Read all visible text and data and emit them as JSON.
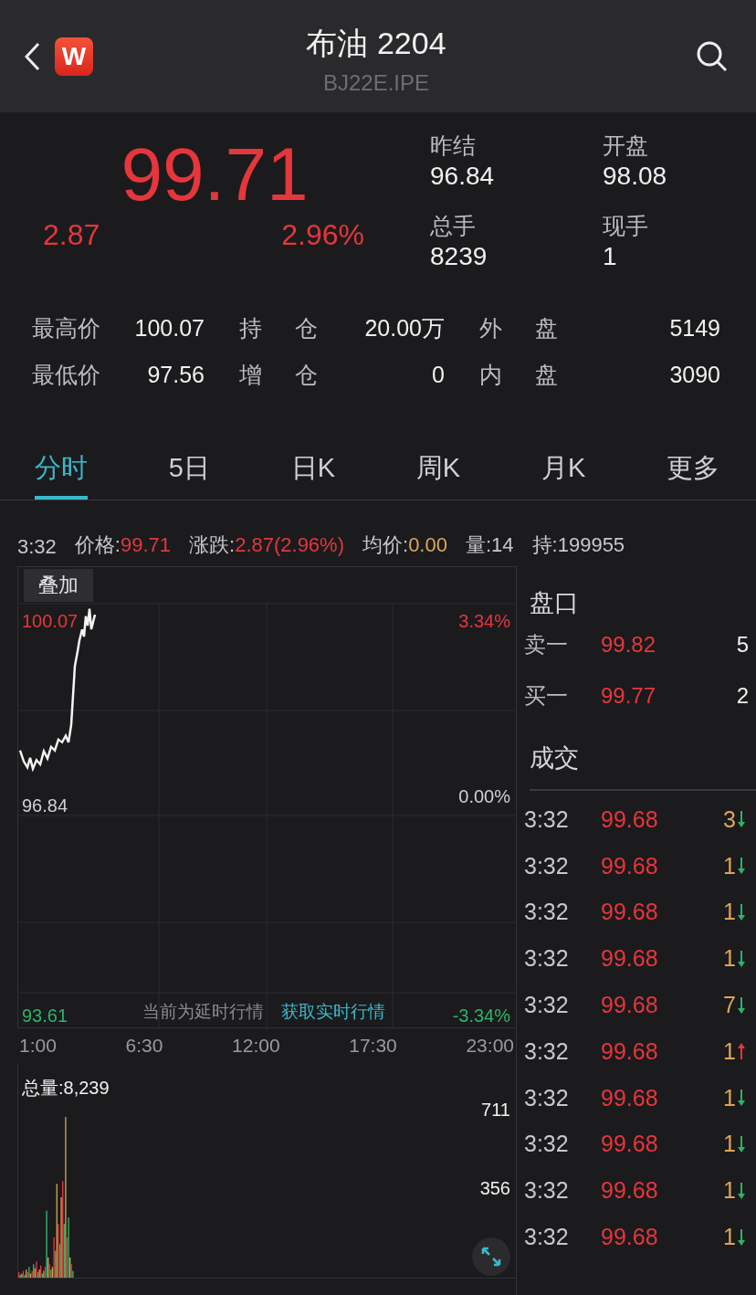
{
  "header": {
    "title": "布油 2204",
    "code": "BJ22E.IPE",
    "logo": "W"
  },
  "quote": {
    "price": "99.71",
    "change": "2.87",
    "change_pct": "2.96%",
    "fields": [
      {
        "label": "昨结",
        "value": "96.84"
      },
      {
        "label": "开盘",
        "value": "98.08"
      },
      {
        "label": "总手",
        "value": "8239"
      },
      {
        "label": "现手",
        "value": "1"
      }
    ]
  },
  "stats": [
    {
      "cells": [
        {
          "label": "最高价",
          "value": "100.07"
        },
        {
          "label": "持仓",
          "value": "20.00万"
        },
        {
          "label": "外盘",
          "value": "5149"
        }
      ]
    },
    {
      "cells": [
        {
          "label": "最低价",
          "value": "97.56"
        },
        {
          "label": "增仓",
          "value": "0"
        },
        {
          "label": "内盘",
          "value": "3090"
        }
      ]
    }
  ],
  "tabs": [
    {
      "label": "分时",
      "selected": true
    },
    {
      "label": "5日",
      "selected": false
    },
    {
      "label": "日K",
      "selected": false
    },
    {
      "label": "周K",
      "selected": false
    },
    {
      "label": "月K",
      "selected": false
    },
    {
      "label": "更多",
      "selected": false
    }
  ],
  "info_bar": [
    {
      "label": "3:32",
      "kind": "plain"
    },
    {
      "label": "价格:",
      "value": "99.71",
      "kind": "up"
    },
    {
      "label": "涨跌:",
      "value": "2.87(2.96%)",
      "kind": "up"
    },
    {
      "label": "均价:",
      "value": "0.00",
      "kind": "avg"
    },
    {
      "label": "量:",
      "value": "14",
      "kind": "plain"
    },
    {
      "label": "持:",
      "value": "199955",
      "kind": "plain"
    }
  ],
  "chart": {
    "overlay_button": "叠加",
    "high": "100.07",
    "base": "96.84",
    "low": "93.61",
    "high_pct": "3.34%",
    "base_pct": "0.00%",
    "low_pct": "-3.34%",
    "notice": "当前为延时行情",
    "notice_link": "获取实时行情",
    "times": [
      "1:00",
      "6:30",
      "12:00",
      "17:30",
      "23:00"
    ],
    "volume_label": "总量:8,239",
    "volume_ticks": [
      "711",
      "356"
    ]
  },
  "book": {
    "title": "盘口",
    "levels": [
      {
        "label": "卖一",
        "price": "99.82",
        "qty": "5"
      },
      {
        "label": "买一",
        "price": "99.77",
        "qty": "2"
      }
    ],
    "trades_title": "成交",
    "trades": [
      {
        "time": "3:32",
        "price": "99.68",
        "qty": "3",
        "kind": "down"
      },
      {
        "time": "3:32",
        "price": "99.68",
        "qty": "1",
        "kind": "down"
      },
      {
        "time": "3:32",
        "price": "99.68",
        "qty": "1",
        "kind": "down"
      },
      {
        "time": "3:32",
        "price": "99.68",
        "qty": "1",
        "kind": "down"
      },
      {
        "time": "3:32",
        "price": "99.68",
        "qty": "7",
        "kind": "down"
      },
      {
        "time": "3:32",
        "price": "99.68",
        "qty": "1",
        "kind": "up"
      },
      {
        "time": "3:32",
        "price": "99.68",
        "qty": "1",
        "kind": "down"
      },
      {
        "time": "3:32",
        "price": "99.68",
        "qty": "1",
        "kind": "down"
      },
      {
        "time": "3:32",
        "price": "99.68",
        "qty": "1",
        "kind": "down"
      },
      {
        "time": "3:32",
        "price": "99.68",
        "qty": "1",
        "kind": "down"
      }
    ]
  }
}
